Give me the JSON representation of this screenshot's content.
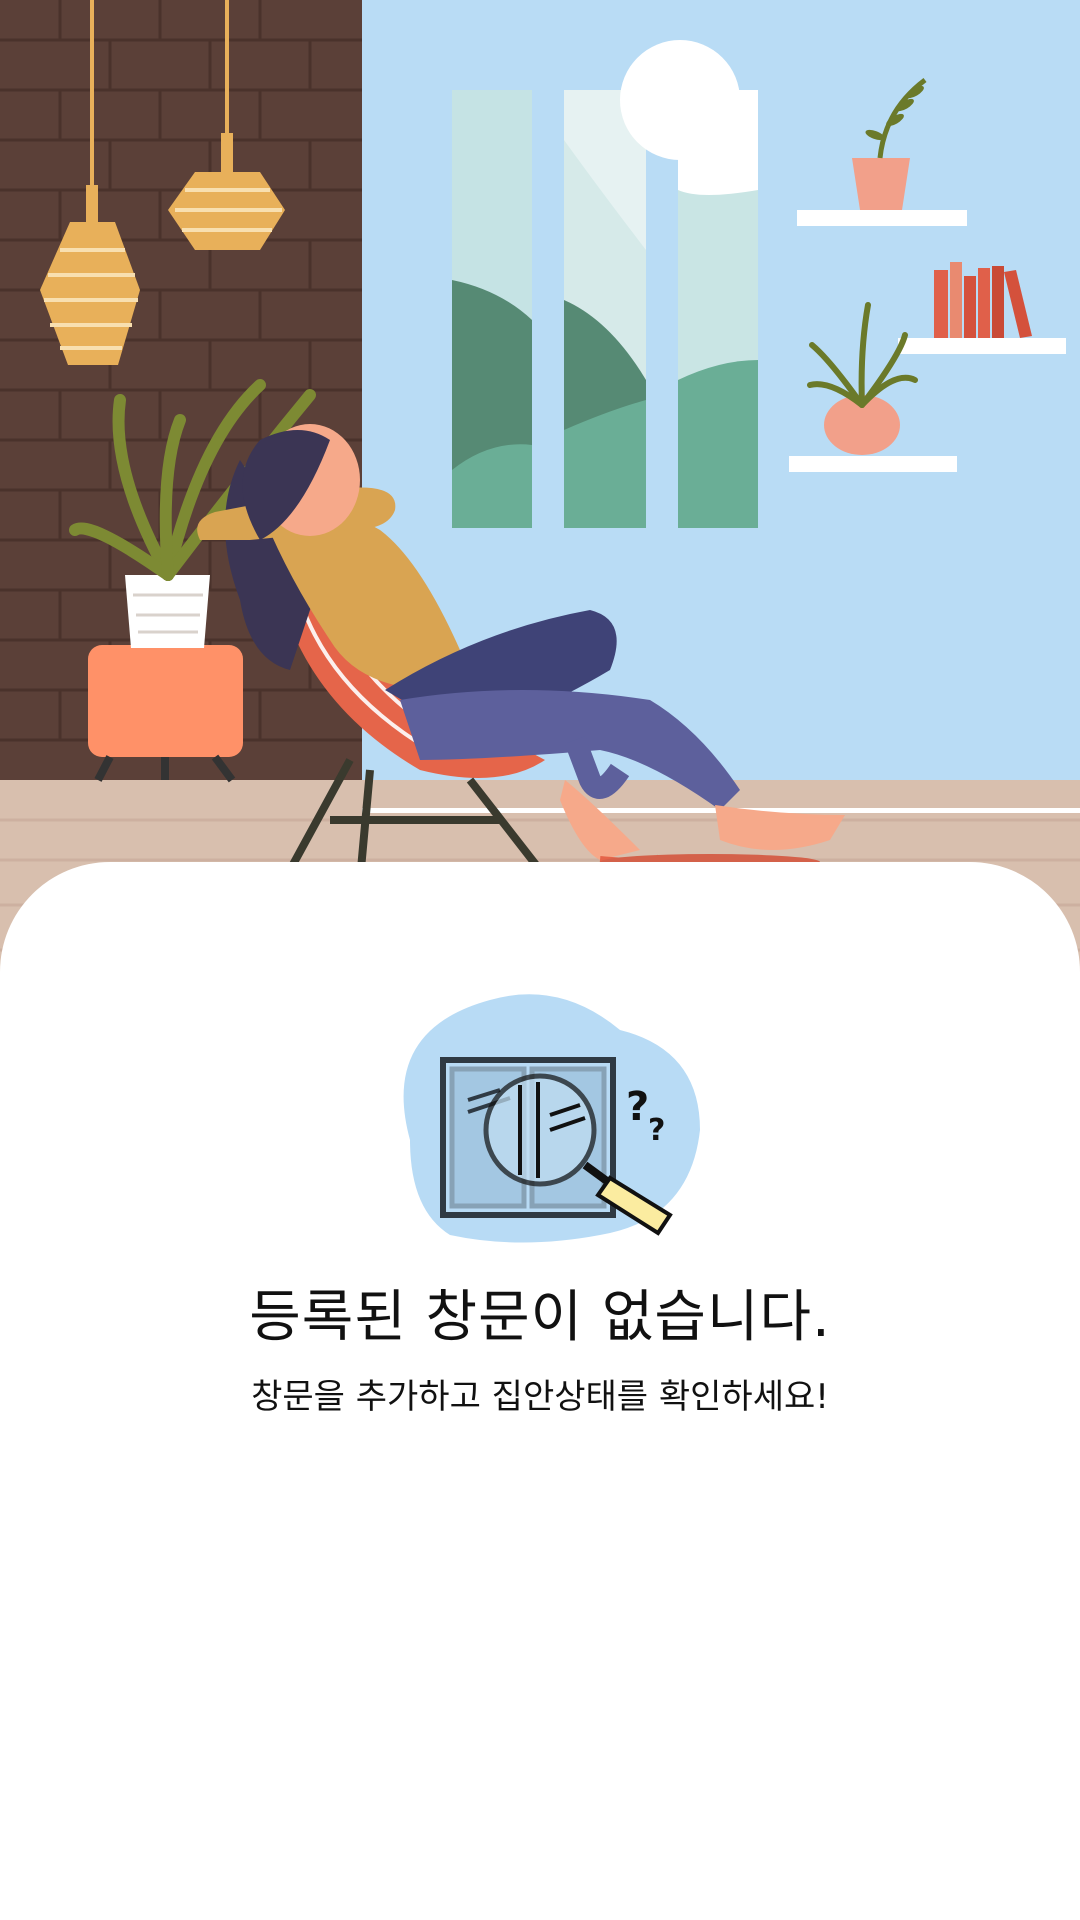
{
  "hero": {
    "icon": "relaxing-woman-illustration"
  },
  "empty_state": {
    "icon": "window-search-icon",
    "title": "등록된 창문이 없습니다.",
    "subtitle": "창문을 추가하고 집안상태를 확인하세요!"
  },
  "colors": {
    "sky": "#b8dcf5",
    "brick_wall": "#5a3f36",
    "floor": "#d9bfae",
    "accent_blob": "#b8dbf5",
    "magnifier_handle": "#fbeca0"
  }
}
